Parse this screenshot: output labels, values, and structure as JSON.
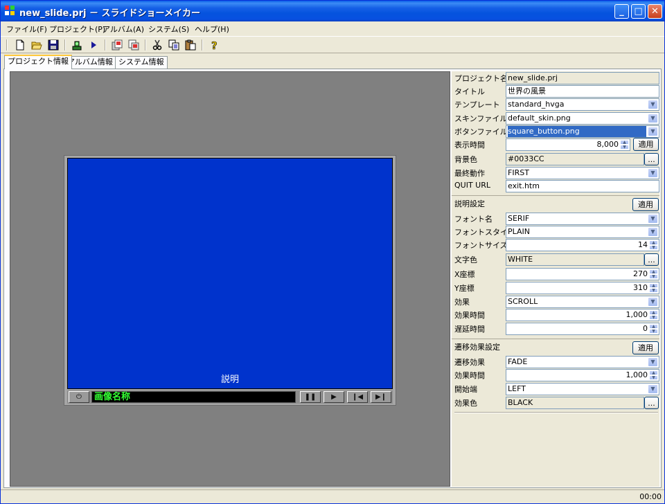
{
  "window": {
    "title": "new_slide.prj － スライドショーメイカー",
    "minimize": "_",
    "maximize": "□",
    "close": "✕"
  },
  "menu": [
    "ファイル(F)",
    "プロジェクト(P)",
    "アルバム(A)",
    "システム(S)",
    "ヘルプ(H)"
  ],
  "toolbar": {
    "icons": [
      "new-icon",
      "open-icon",
      "save-icon",
      "export-icon",
      "play-icon",
      "copy-slide-icon",
      "paste-slide-icon",
      "cut-icon",
      "copy-icon",
      "paste-icon",
      "help-icon"
    ]
  },
  "tabs": [
    "プロジェクト情報",
    "アルバム情報",
    "システム情報"
  ],
  "preview": {
    "caption": "説明",
    "image_name": "画像名称",
    "screen_color": "#0033CC"
  },
  "props": {
    "project_name": {
      "label": "プロジェクト名",
      "value": "new_slide.prj"
    },
    "title": {
      "label": "タイトル",
      "value": "世界の風景"
    },
    "template": {
      "label": "テンプレート",
      "value": "standard_hvga"
    },
    "skin_file": {
      "label": "スキンファイル",
      "value": "default_skin.png"
    },
    "button_file": {
      "label": "ボタンファイル",
      "value": "square_button.png"
    },
    "display_time": {
      "label": "表示時間",
      "value": "8,000"
    },
    "bg_color": {
      "label": "背景色",
      "value": "#0033CC"
    },
    "final_action": {
      "label": "最終動作",
      "value": "FIRST"
    },
    "quit_url": {
      "label": "QUIT URL",
      "value": "exit.htm"
    },
    "desc_section": "説明設定",
    "font_name": {
      "label": "フォント名",
      "value": "SERIF"
    },
    "font_style": {
      "label": "フォントスタイル",
      "value": "PLAIN"
    },
    "font_size": {
      "label": "フォントサイズ",
      "value": "14"
    },
    "text_color": {
      "label": "文字色",
      "value": "WHITE"
    },
    "x_coord": {
      "label": "X座標",
      "value": "270"
    },
    "y_coord": {
      "label": "Y座標",
      "value": "310"
    },
    "effect": {
      "label": "効果",
      "value": "SCROLL"
    },
    "effect_time": {
      "label": "効果時間",
      "value": "1,000"
    },
    "delay_time": {
      "label": "遅延時間",
      "value": "0"
    },
    "trans_section": "遷移効果設定",
    "trans_effect": {
      "label": "遷移効果",
      "value": "FADE"
    },
    "trans_effect_time": {
      "label": "効果時間",
      "value": "1,000"
    },
    "start_edge": {
      "label": "開始端",
      "value": "LEFT"
    },
    "effect_color": {
      "label": "効果色",
      "value": "BLACK"
    },
    "apply_label": "適用",
    "ellipsis_label": "..."
  },
  "status": {
    "time": "00:00"
  }
}
